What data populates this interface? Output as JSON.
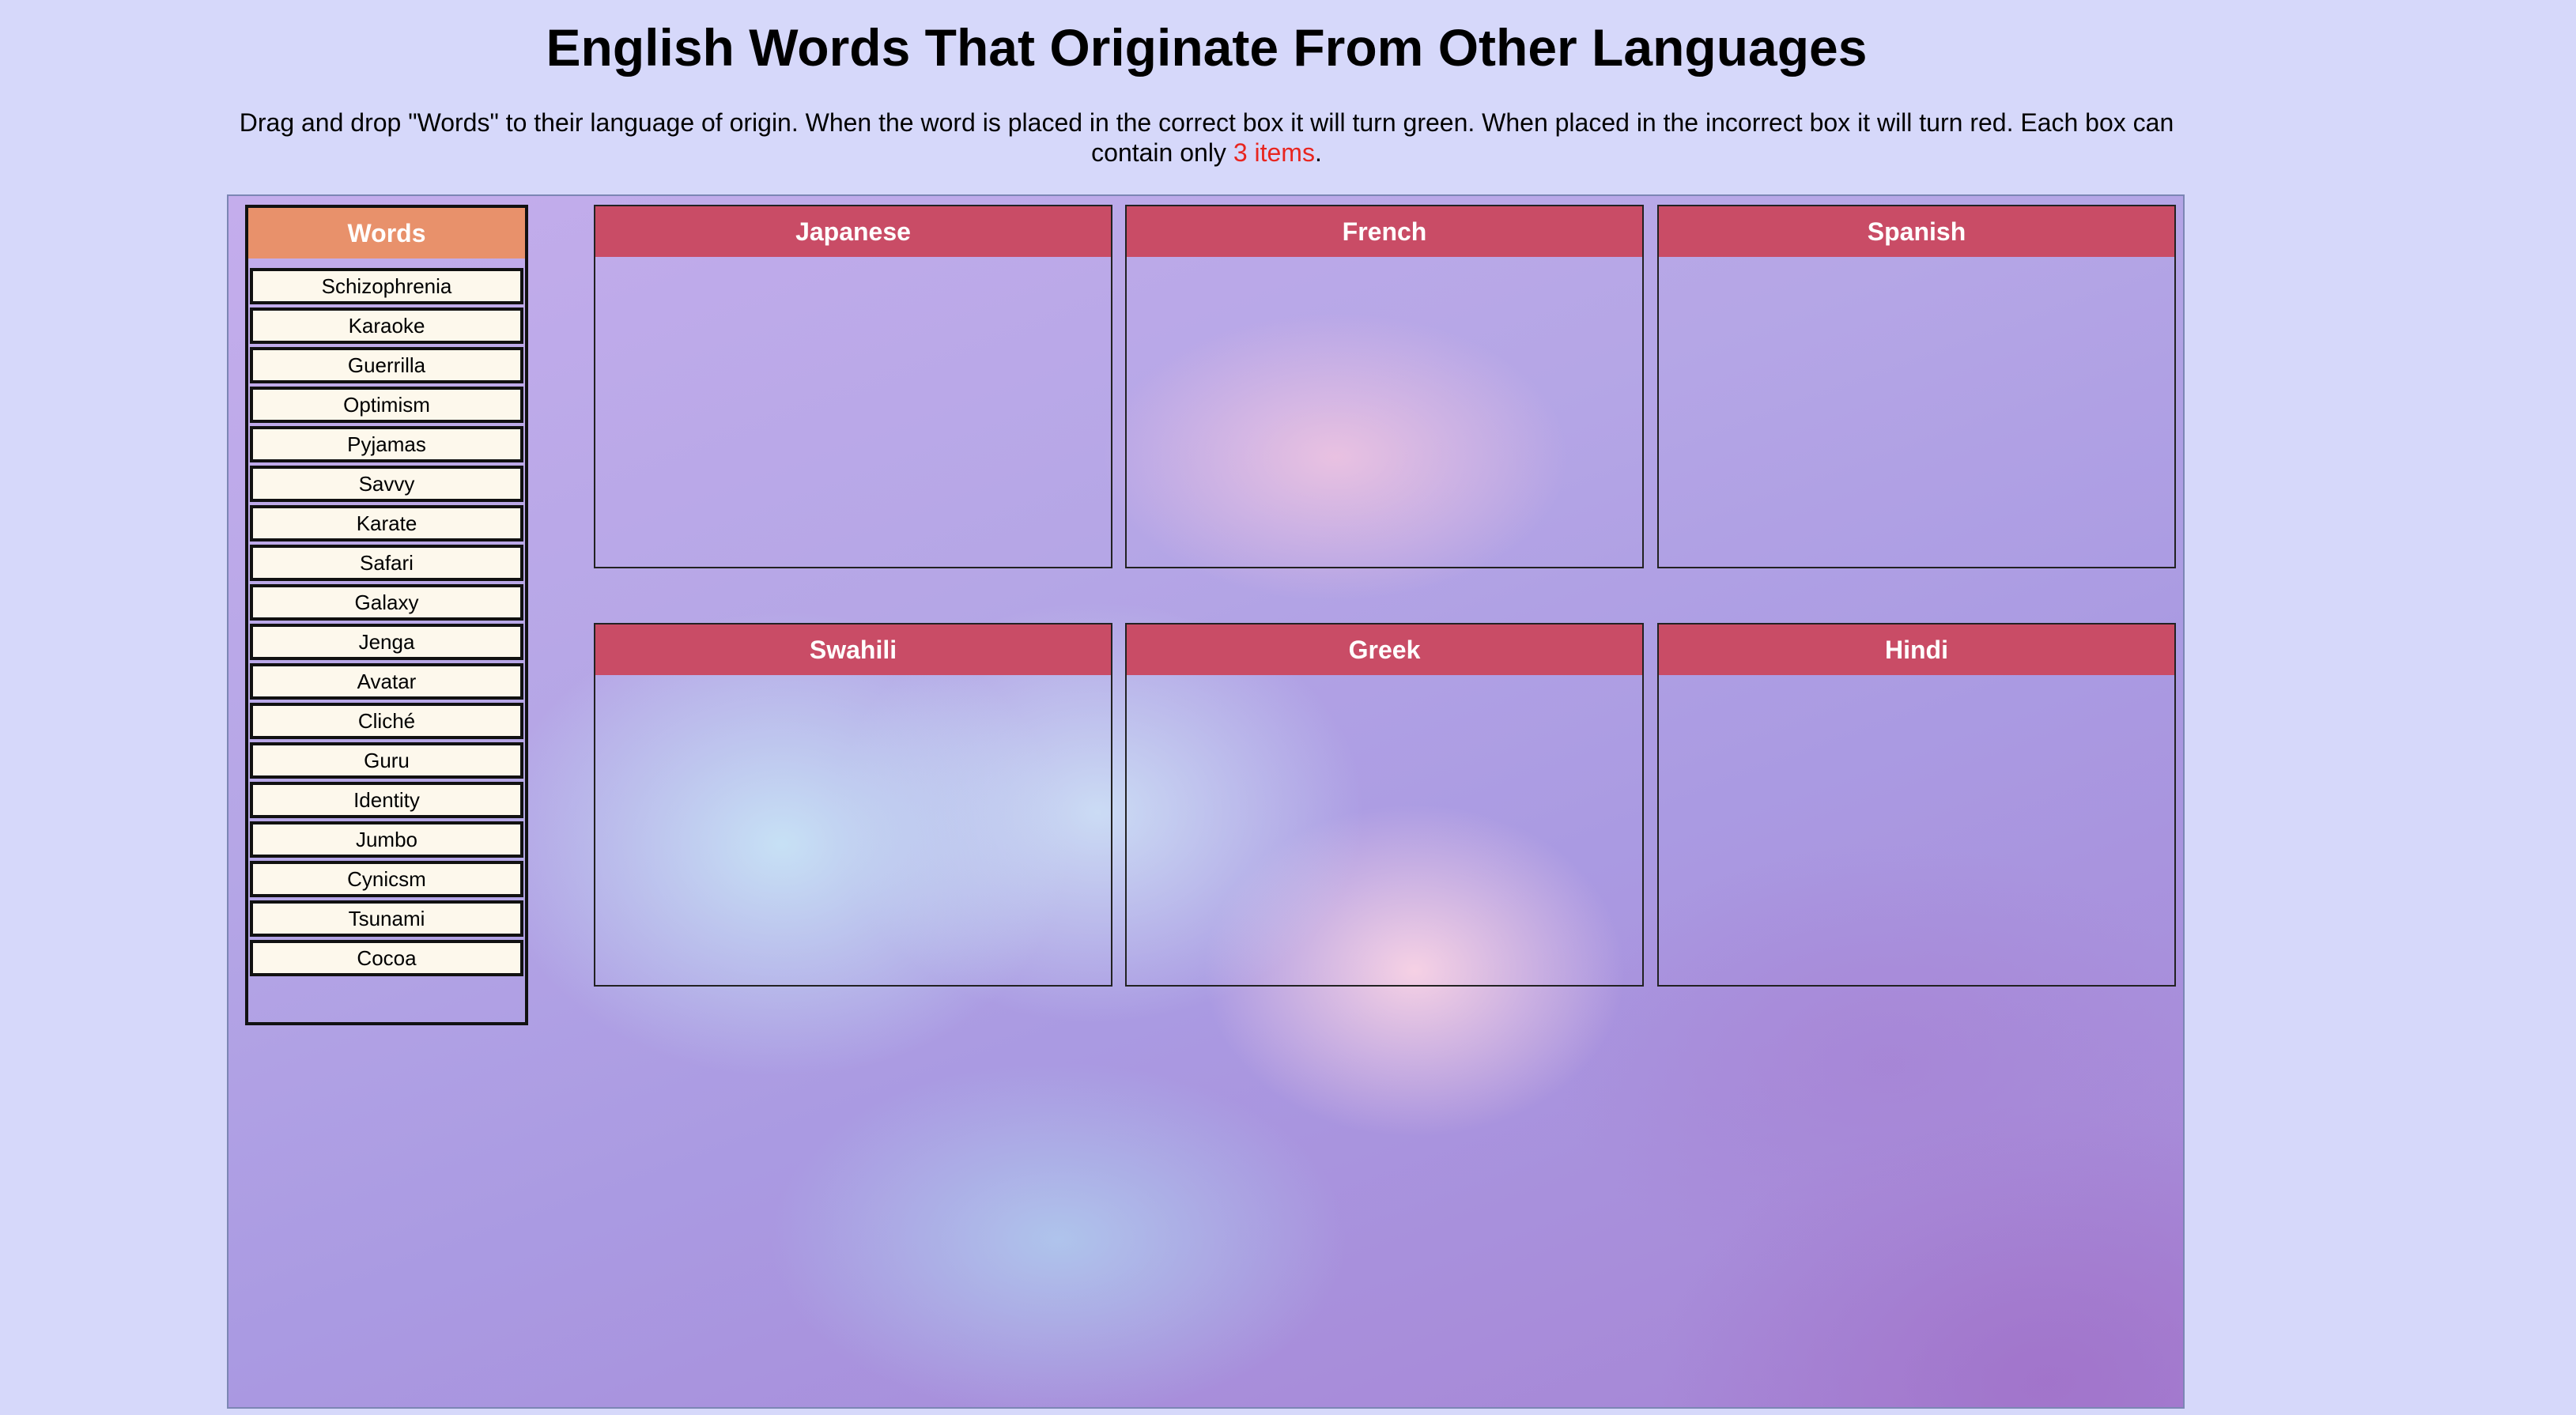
{
  "page": {
    "title": "English Words That Originate From Other Languages",
    "instructions_before": "Drag and drop \"Words\" to their language of origin. When the word is placed in the correct box it will turn green. When placed in the incorrect box it will turn red. Each box can contain only ",
    "instructions_limit": "3 items",
    "instructions_after": "."
  },
  "word_bank": {
    "title": "Words",
    "words": [
      "Schizophrenia",
      "Karaoke",
      "Guerrilla",
      "Optimism",
      "Pyjamas",
      "Savvy",
      "Karate",
      "Safari",
      "Galaxy",
      "Jenga",
      "Avatar",
      "Cliché",
      "Guru",
      "Identity",
      "Jumbo",
      "Cynicsm",
      "Tsunami",
      "Cocoa"
    ]
  },
  "zones": [
    {
      "label": "Japanese"
    },
    {
      "label": "French"
    },
    {
      "label": "Spanish"
    },
    {
      "label": "Swahili"
    },
    {
      "label": "Greek"
    },
    {
      "label": "Hindi"
    }
  ],
  "colors": {
    "page_background": "#d6d8fa",
    "word_bank_header": "#e8916b",
    "zone_header": "#c94c66",
    "word_background": "#fdf8ec",
    "limit_text": "#e8251f"
  }
}
